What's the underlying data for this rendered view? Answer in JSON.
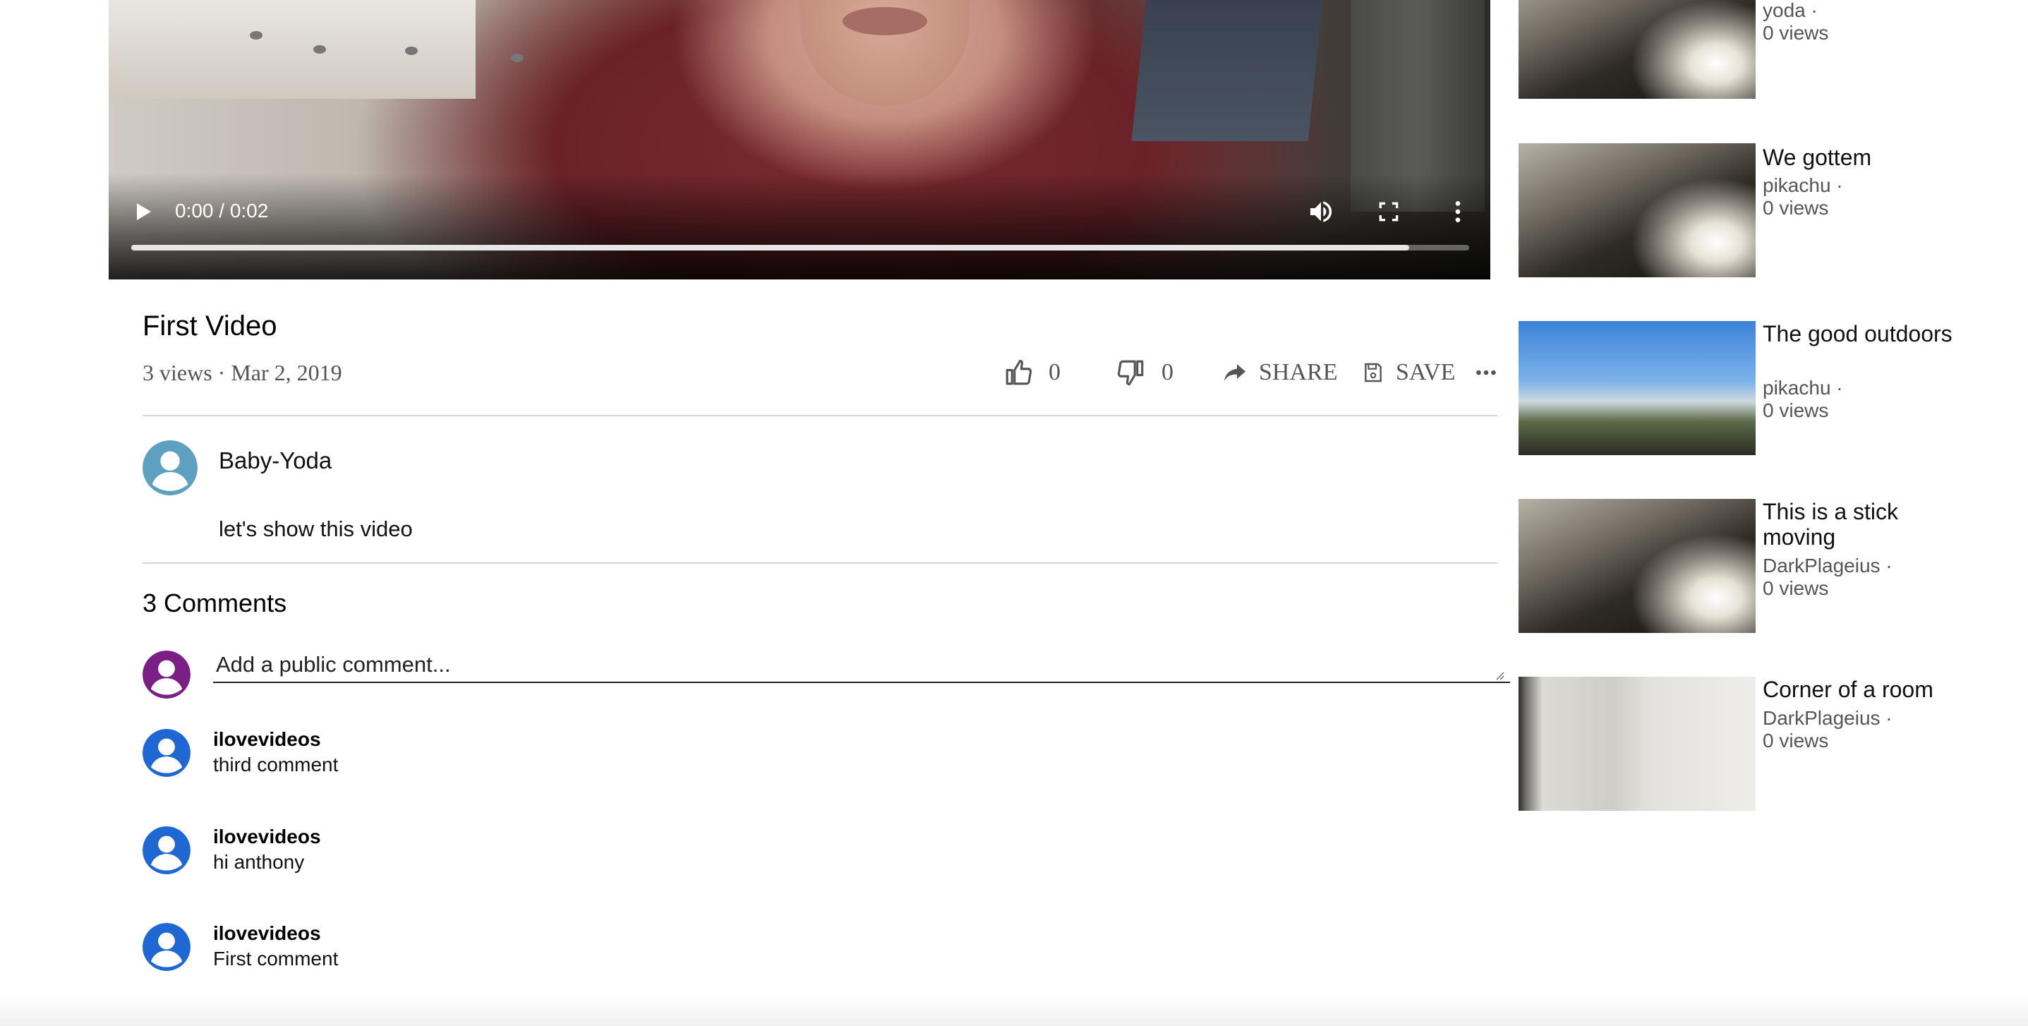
{
  "player": {
    "time": "0:00 / 0:02",
    "progress_fraction": 0.955
  },
  "video": {
    "title": "First Video",
    "meta": "3 views · Mar 2, 2019",
    "likes": "0",
    "dislikes": "0",
    "share_label": "SHARE",
    "save_label": "SAVE"
  },
  "channel": {
    "name": "Baby-Yoda",
    "description": "let's show this video"
  },
  "comments": {
    "count_label": "3 Comments",
    "input_placeholder": "Add a public comment...",
    "items": [
      {
        "author": "ilovevideos",
        "text": "third comment"
      },
      {
        "author": "ilovevideos",
        "text": "hi anthony"
      },
      {
        "author": "ilovevideos",
        "text": "First comment"
      }
    ]
  },
  "sidebar": {
    "items": [
      {
        "title": "",
        "channel": "yoda ·",
        "views": "0 views"
      },
      {
        "title": "We gottem",
        "channel": "pikachu ·",
        "views": "0 views"
      },
      {
        "title": "The good outdoors",
        "channel": "pikachu ·",
        "views": "0 views"
      },
      {
        "title": "This is a stick moving",
        "channel": "DarkPlageius ·",
        "views": "0 views"
      },
      {
        "title": "Corner of a room",
        "channel": "DarkPlageius ·",
        "views": "0 views"
      }
    ]
  },
  "colors": {
    "channel_avatar": "#5ea0c0",
    "my_avatar": "#7b1f86",
    "commenter_avatar": "#1f67d2"
  }
}
